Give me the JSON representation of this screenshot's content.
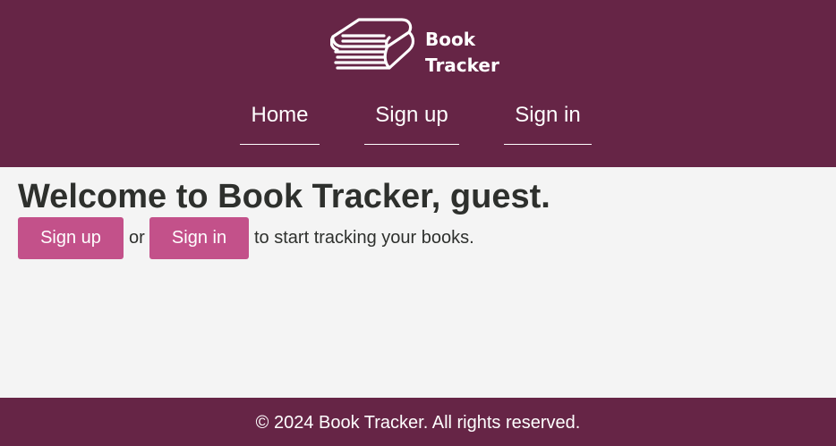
{
  "brand": {
    "line1": "Book",
    "line2": "Tracker",
    "icon": "book-stack-icon"
  },
  "nav": {
    "home": "Home",
    "sign_up": "Sign up",
    "sign_in": "Sign in"
  },
  "main": {
    "heading": "Welcome to Book Tracker, guest.",
    "sign_up_button": "Sign up",
    "or_text": "or",
    "sign_in_button": "Sign in",
    "tail_text": "to start tracking your books."
  },
  "footer": {
    "text": "© 2024 Book Tracker. All rights reserved."
  },
  "colors": {
    "header_bg": "#662546",
    "page_bg": "#f4f4f4",
    "button_bg": "#c3518a",
    "text": "#2e302d"
  }
}
